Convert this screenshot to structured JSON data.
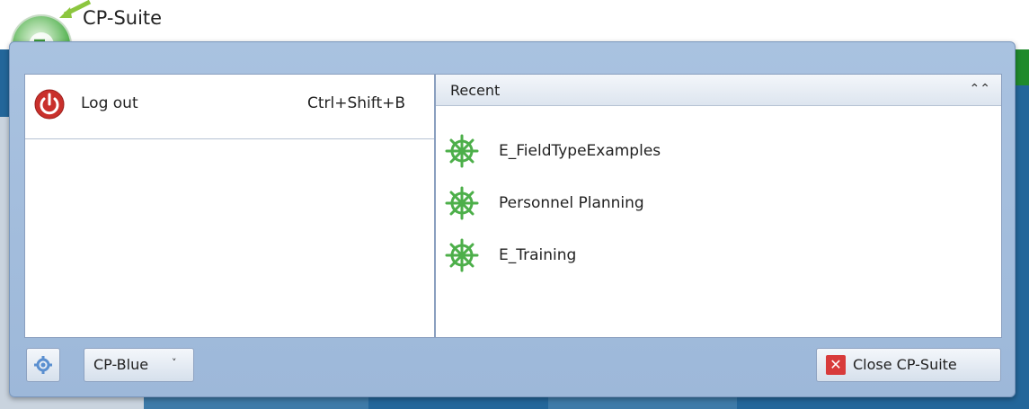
{
  "app": {
    "title": "CP-Suite"
  },
  "menu": {
    "left": {
      "logout_label": "Log out",
      "logout_shortcut": "Ctrl+Shift+B"
    },
    "recent": {
      "header": "Recent",
      "collapse_glyph": "⌃",
      "items": [
        {
          "label": "E_FieldTypeExamples",
          "icon": "ship-wheel-icon"
        },
        {
          "label": "Personnel Planning",
          "icon": "ship-wheel-icon"
        },
        {
          "label": "E_Training",
          "icon": "ship-wheel-icon"
        }
      ]
    },
    "footer": {
      "theme_value": "CP-Blue",
      "close_label": "Close CP-Suite"
    }
  },
  "colors": {
    "accent_green": "#4daf4a",
    "logout_red": "#d83b3b",
    "frame_blue": "#a9c2e0"
  }
}
